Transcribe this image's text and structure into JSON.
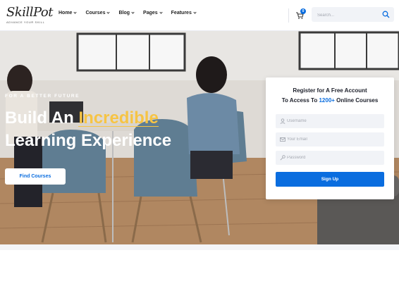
{
  "brand": {
    "logo_text": "SkillPot",
    "logo_tagline": "ADVANCE YOUR SKILL"
  },
  "nav": {
    "items": [
      {
        "label": "Home"
      },
      {
        "label": "Courses"
      },
      {
        "label": "Blog"
      },
      {
        "label": "Pages"
      },
      {
        "label": "Features"
      }
    ]
  },
  "cart": {
    "icon": "cart-icon",
    "count": "0"
  },
  "search": {
    "placeholder": "Search...",
    "icon": "search-icon"
  },
  "hero": {
    "eyebrow": "FOR A BETTER FUTURE",
    "headline_part1": "Build An ",
    "headline_accent": "Incredible",
    "headline_line2": "Learning Experience",
    "cta_label": "Find Courses"
  },
  "register": {
    "title": "Register for A Free Account",
    "sub_prefix": "To Access To ",
    "sub_highlight": "1200+",
    "sub_suffix": " Online Courses",
    "username_placeholder": "Username",
    "email_placeholder": "Your Email",
    "password_placeholder": "Password",
    "submit_label": "Sign Up"
  },
  "colors": {
    "accent": "#0a6ddf",
    "highlight": "#f6c445",
    "text_dark": "#1c1f2a"
  }
}
